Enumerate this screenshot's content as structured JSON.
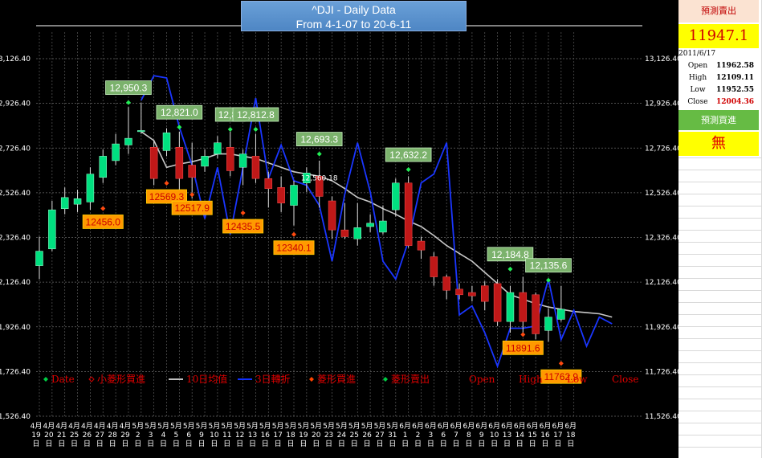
{
  "title": {
    "line1": "^DJI - Daily Data",
    "line2": "From 4-1-07 to 20-6-11"
  },
  "side_panel": {
    "header_sell": "預測賣出",
    "predicted_value": "11947.1",
    "date": "2011/6/17",
    "rows": [
      {
        "label": "Open",
        "value": "11962.58",
        "color": "#000000"
      },
      {
        "label": "High",
        "value": "12109.11",
        "color": "#000000"
      },
      {
        "label": "Low",
        "value": "11952.55",
        "color": "#000000"
      },
      {
        "label": "Close",
        "value": "12004.36",
        "color": "#d00000"
      }
    ],
    "header_buy": "預測買進",
    "buy_value": "無"
  },
  "legend": [
    {
      "label": "Date",
      "marker": "diamond",
      "color": "#00cc44"
    },
    {
      "label": "小菱形買進",
      "marker": "diamond-outline",
      "color": "#cc0000"
    },
    {
      "label": "10日均值",
      "marker": "line",
      "color": "#c0c0c0"
    },
    {
      "label": "3日轉折",
      "marker": "line",
      "color": "#1030ff"
    },
    {
      "label": "菱形買進",
      "marker": "diamond",
      "color": "#ff4400"
    },
    {
      "label": "菱形賣出",
      "marker": "diamond",
      "color": "#00cc44"
    },
    {
      "label": "Open",
      "marker": "none",
      "color": "#ff0000"
    },
    {
      "label": "High",
      "marker": "none",
      "color": "#ff0000"
    },
    {
      "label": "Low",
      "marker": "none",
      "color": "#ff0000"
    },
    {
      "label": "Close",
      "marker": "none",
      "color": "#ff0000"
    }
  ],
  "chart_data": {
    "type": "candlestick",
    "ylim": [
      11526.4,
      13126.4
    ],
    "ytick_labels": [
      "13,126.40",
      "12,926.40",
      "12,726.40",
      "12,526.40",
      "12,326.40",
      "12,126.40",
      "11,926.40",
      "11,726.40",
      "11,526.40"
    ],
    "yticks": [
      13126.4,
      12926.4,
      12726.4,
      12526.4,
      12326.4,
      12126.4,
      11926.4,
      11726.4,
      11526.4
    ],
    "dates": [
      "4月19日",
      "4月20日",
      "4月21日",
      "4月25日",
      "4月26日",
      "4月27日",
      "4月28日",
      "4月29日",
      "5月2日",
      "5月3日",
      "5月4日",
      "5月5日",
      "5月6日",
      "5月9日",
      "5月10日",
      "5月11日",
      "5月12日",
      "5月13日",
      "5月16日",
      "5月17日",
      "5月18日",
      "5月19日",
      "5月20日",
      "5月23日",
      "5月24日",
      "5月25日",
      "5月26日",
      "5月27日",
      "5月31日",
      "6月1日",
      "6月2日",
      "6月3日",
      "6月6日",
      "6月7日",
      "6月8日",
      "6月9日",
      "6月10日",
      "6月13日",
      "6月14日",
      "6月15日",
      "6月16日",
      "6月17日",
      "6月18日"
    ],
    "candles": [
      {
        "o": 12200,
        "c": 12265,
        "h": 12330,
        "l": 12140
      },
      {
        "o": 12275,
        "c": 12450,
        "h": 12490,
        "l": 12265
      },
      {
        "o": 12455,
        "c": 12505,
        "h": 12550,
        "l": 12430
      },
      {
        "o": 12475,
        "c": 12500,
        "h": 12540,
        "l": 12440
      },
      {
        "o": 12485,
        "c": 12610,
        "h": 12640,
        "l": 12450
      },
      {
        "o": 12595,
        "c": 12690,
        "h": 12720,
        "l": 12570
      },
      {
        "o": 12670,
        "c": 12745,
        "h": 12790,
        "l": 12650
      },
      {
        "o": 12740,
        "c": 12770,
        "h": 12910,
        "l": 12700
      },
      {
        "o": 12805,
        "c": 12805,
        "h": 12930,
        "l": 12790
      },
      {
        "o": 12730,
        "c": 12590,
        "h": 12760,
        "l": 12560
      },
      {
        "o": 12715,
        "c": 12795,
        "h": 12815,
        "l": 12690
      },
      {
        "o": 12730,
        "c": 12590,
        "h": 12800,
        "l": 12540
      },
      {
        "o": 12650,
        "c": 12595,
        "h": 12750,
        "l": 12500
      },
      {
        "o": 12645,
        "c": 12690,
        "h": 12720,
        "l": 12620
      },
      {
        "o": 12700,
        "c": 12750,
        "h": 12780,
        "l": 12680
      },
      {
        "o": 12730,
        "c": 12625,
        "h": 12800,
        "l": 12600
      },
      {
        "o": 12640,
        "c": 12700,
        "h": 12720,
        "l": 12560
      },
      {
        "o": 12690,
        "c": 12590,
        "h": 12790,
        "l": 12570
      },
      {
        "o": 12590,
        "c": 12545,
        "h": 12620,
        "l": 12460
      },
      {
        "o": 12550,
        "c": 12480,
        "h": 12600,
        "l": 12440
      },
      {
        "o": 12470,
        "c": 12560,
        "h": 12580,
        "l": 12380
      },
      {
        "o": 12570,
        "c": 12615,
        "h": 12640,
        "l": 12530
      },
      {
        "o": 12600,
        "c": 12510,
        "h": 12670,
        "l": 12460
      },
      {
        "o": 12490,
        "c": 12360,
        "h": 12510,
        "l": 12320
      },
      {
        "o": 12360,
        "c": 12330,
        "h": 12480,
        "l": 12320
      },
      {
        "o": 12320,
        "c": 12370,
        "h": 12480,
        "l": 12290
      },
      {
        "o": 12375,
        "c": 12390,
        "h": 12430,
        "l": 12350
      },
      {
        "o": 12350,
        "c": 12400,
        "h": 12470,
        "l": 12340
      },
      {
        "o": 12450,
        "c": 12570,
        "h": 12590,
        "l": 12420
      },
      {
        "o": 12570,
        "c": 12290,
        "h": 12600,
        "l": 12280
      },
      {
        "o": 12310,
        "c": 12270,
        "h": 12330,
        "l": 12230
      },
      {
        "o": 12240,
        "c": 12150,
        "h": 12260,
        "l": 12110
      },
      {
        "o": 12150,
        "c": 12090,
        "h": 12160,
        "l": 12050
      },
      {
        "o": 12095,
        "c": 12070,
        "h": 12120,
        "l": 12050
      },
      {
        "o": 12080,
        "c": 12065,
        "h": 12110,
        "l": 12040
      },
      {
        "o": 12110,
        "c": 12040,
        "h": 12130,
        "l": 12000
      },
      {
        "o": 12120,
        "c": 11950,
        "h": 12140,
        "l": 11930
      },
      {
        "o": 11950,
        "c": 12080,
        "h": 12110,
        "l": 11900
      },
      {
        "o": 12080,
        "c": 11950,
        "h": 12150,
        "l": 11900
      },
      {
        "o": 12070,
        "c": 11895,
        "h": 12080,
        "l": 11870
      },
      {
        "o": 11910,
        "c": 11970,
        "h": 12010,
        "l": 11860
      },
      {
        "o": 11960,
        "c": 12005,
        "h": 12110,
        "l": 11950
      }
    ],
    "ma10": [
      null,
      null,
      null,
      null,
      null,
      null,
      null,
      null,
      12800,
      12760,
      12640,
      12655,
      12665,
      12680,
      12700,
      12700,
      12690,
      12680,
      12660,
      12640,
      12620,
      12610,
      12600,
      12580,
      12545,
      12505,
      12485,
      12455,
      12430,
      12400,
      12375,
      12335,
      12290,
      12255,
      12220,
      12170,
      12120,
      12070,
      12050,
      12030,
      12015,
      12005,
      11995,
      11990,
      11985,
      11970
    ],
    "turn3": [
      null,
      null,
      null,
      null,
      null,
      null,
      null,
      null,
      12940,
      13050,
      13040,
      12820,
      12650,
      12410,
      12640,
      12340,
      12640,
      12950,
      12590,
      12740,
      12580,
      12560,
      12470,
      12220,
      12520,
      12750,
      12530,
      12220,
      12140,
      12310,
      12570,
      12610,
      12750,
      11980,
      12020,
      11900,
      11750,
      11920,
      11920,
      11930,
      12140,
      11870,
      12000,
      11840,
      11970,
      11940
    ],
    "green_diamonds": [
      {
        "i": 7,
        "v": 12930,
        "label": "12,950.3"
      },
      {
        "i": 11,
        "v": 12820,
        "label": "12,821.0"
      },
      {
        "i": 15,
        "v": 12810,
        "label": "12,81"
      },
      {
        "i": 17,
        "v": 12810,
        "label": "12,812.8"
      },
      {
        "i": 22,
        "v": 12700,
        "label": "12,693.3"
      },
      {
        "i": 29,
        "v": 12630,
        "label": "12,632.2"
      },
      {
        "i": 37,
        "v": 12185,
        "label": "12,184.8"
      },
      {
        "i": 40,
        "v": 12135,
        "label": "12,135.6"
      }
    ],
    "orange_diamonds": [
      {
        "i": 5,
        "v": 12456,
        "label": "12456.0"
      },
      {
        "i": 10,
        "v": 12569,
        "label": "12569.3"
      },
      {
        "i": 12,
        "v": 12518,
        "label": "12517.9"
      },
      {
        "i": 16,
        "v": 12436,
        "label": "12435.5"
      },
      {
        "i": 20,
        "v": 12340,
        "label": "12340.1"
      },
      {
        "i": 38,
        "v": 11892,
        "label": "11891.6"
      },
      {
        "i": 41,
        "v": 11763,
        "label": "11762.9"
      }
    ],
    "extra_label": {
      "i": 22,
      "v": 12560,
      "label": "12,560.18"
    }
  }
}
